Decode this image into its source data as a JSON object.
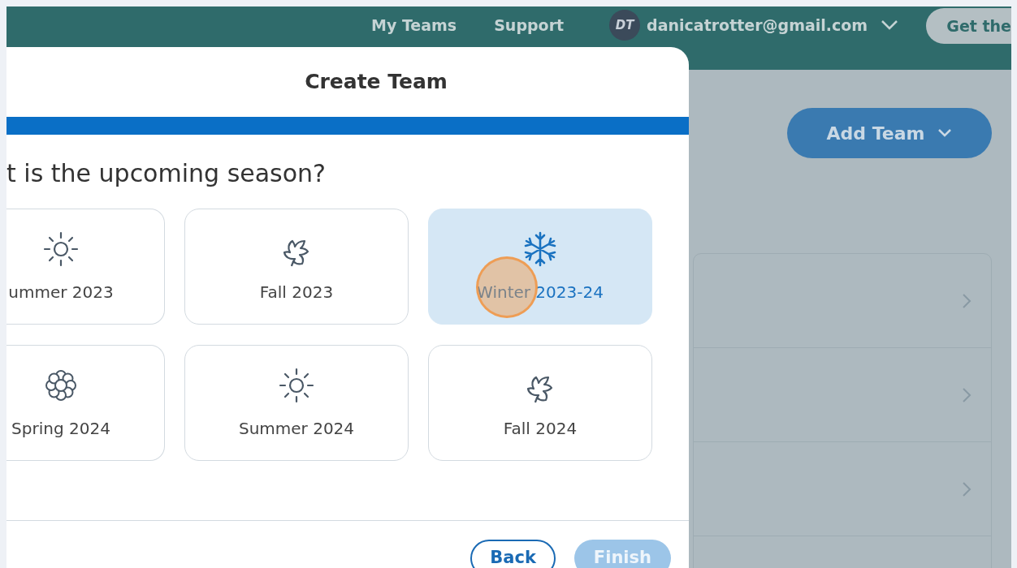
{
  "header": {
    "nav": [
      "My Teams",
      "Support"
    ],
    "account": {
      "initials": "DT",
      "email": "danicatrotter@gmail.com"
    },
    "cta": "Get the"
  },
  "background": {
    "add_button": "Add Team"
  },
  "modal": {
    "title": "Create Team",
    "progress": {
      "level": 1
    },
    "question": "t is the upcoming season?",
    "seasons": [
      {
        "label": "ummer 2023",
        "kind": "sun",
        "selected": false
      },
      {
        "label": "Fall 2023",
        "kind": "leaf",
        "selected": false
      },
      {
        "label": "Winter 2023-24",
        "kind": "snow",
        "selected": true
      },
      {
        "label": "Spring 2024",
        "kind": "flower",
        "selected": false
      },
      {
        "label": "Summer 2024",
        "kind": "sun",
        "selected": false
      },
      {
        "label": "Fall 2024",
        "kind": "leaf",
        "selected": false
      }
    ],
    "buttons": [
      {
        "label": "Back",
        "disabled": false
      },
      {
        "label": "Finish",
        "disabled": true
      }
    ]
  }
}
